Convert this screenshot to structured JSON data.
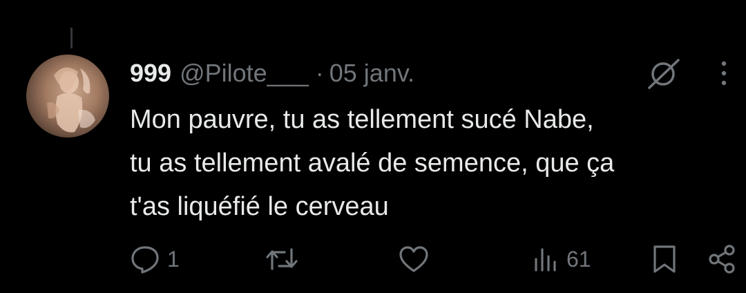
{
  "tweet": {
    "display_name": "999",
    "handle": "@Pilote___",
    "separator": "·",
    "date": "05 janv.",
    "text_lines": [
      "Mon pauvre, tu as tellement sucé Nabe,",
      "tu as tellement avalé de semence, que ça",
      "t'as liquéfié le cerveau"
    ]
  },
  "actions": {
    "reply_count": "1",
    "repost_count": "",
    "like_count": "",
    "views_count": "61"
  },
  "icons": {
    "reply": "reply-icon",
    "repost": "repost-icon",
    "like": "heart-icon",
    "views": "views-icon",
    "bookmark": "bookmark-icon",
    "share": "share-icon",
    "grok": "grok-icon",
    "more": "more-icon"
  },
  "colors": {
    "background": "#000000",
    "text_primary": "#e7e9ea",
    "text_secondary": "#71767b"
  }
}
